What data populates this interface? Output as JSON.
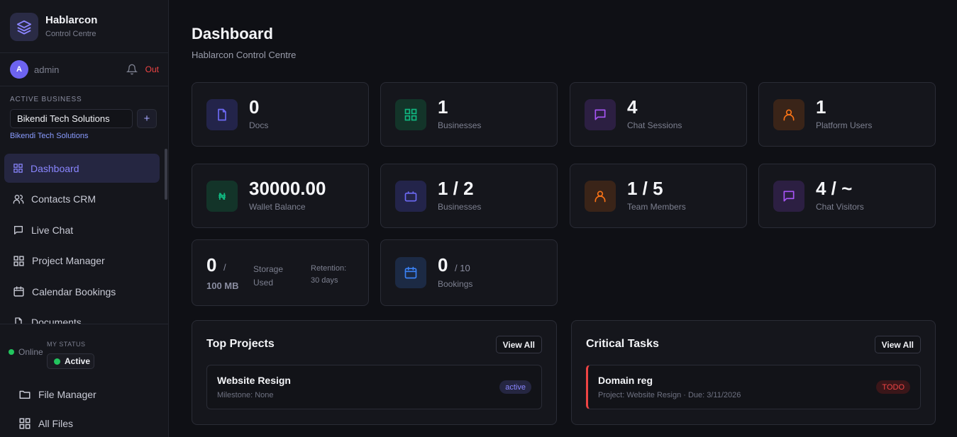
{
  "brand": {
    "name": "Hablarcon",
    "subtitle": "Control Centre"
  },
  "user": {
    "avatar_letter": "A",
    "name": "admin",
    "logout_label": "Out"
  },
  "business": {
    "section_label": "ACTIVE BUSINESS",
    "selected": "Bikendi Tech Solutions",
    "add_label": "+",
    "current_link": "Bikendi Tech Solutions"
  },
  "nav": [
    {
      "label": "Dashboard",
      "icon": "grid-icon",
      "active": true
    },
    {
      "label": "Contacts CRM",
      "icon": "users-icon"
    },
    {
      "label": "Live Chat",
      "icon": "chat-icon"
    },
    {
      "label": "Project Manager",
      "icon": "grid-icon"
    },
    {
      "label": "Calendar Bookings",
      "icon": "calendar-icon"
    },
    {
      "label": "Documents",
      "icon": "document-icon"
    }
  ],
  "status": {
    "online_label": "Online",
    "my_status_label": "MY STATUS",
    "current": "Active"
  },
  "bottom_nav": [
    {
      "label": "File Manager",
      "icon": "folder-icon"
    },
    {
      "label": "All Files",
      "icon": "grid-icon"
    }
  ],
  "page": {
    "title": "Dashboard",
    "subtitle": "Hablarcon Control Centre"
  },
  "stats_row1": [
    {
      "value": "0",
      "label": "Docs",
      "icon": "document-icon",
      "color": "#6366f1"
    },
    {
      "value": "1",
      "label": "Businesses",
      "icon": "grid-icon",
      "color": "#10b981"
    },
    {
      "value": "4",
      "label": "Chat Sessions",
      "icon": "chat-icon",
      "color": "#a855f7"
    },
    {
      "value": "1",
      "label": "Platform Users",
      "icon": "user-icon",
      "color": "#f97316"
    }
  ],
  "stats_row2": [
    {
      "value": "30000.00",
      "label": "Wallet Balance",
      "icon": "naira-icon",
      "glyph": "₦",
      "color": "#10b981"
    },
    {
      "value": "1 / 2",
      "label": "Businesses",
      "icon": "briefcase-icon",
      "color": "#6366f1"
    },
    {
      "value": "1 / 5",
      "label": "Team Members",
      "icon": "user-icon",
      "color": "#f97316"
    },
    {
      "value": "4 / ~",
      "label": "Chat Visitors",
      "icon": "chat-icon",
      "color": "#a855f7"
    }
  ],
  "storage": {
    "value": "0",
    "slash": "/",
    "total": "100 MB",
    "label_line1": "Storage",
    "label_line2": "Used",
    "retention_line1": "Retention:",
    "retention_line2": "30 days"
  },
  "bookings": {
    "value": "0",
    "total": "/ 10",
    "label": "Bookings",
    "icon": "calendar-icon",
    "color": "#3b82f6"
  },
  "top_projects": {
    "title": "Top Projects",
    "view_all": "View All",
    "items": [
      {
        "name": "Website Resign",
        "milestone": "Milestone: None",
        "status": "active"
      }
    ]
  },
  "critical_tasks": {
    "title": "Critical Tasks",
    "view_all": "View All",
    "items": [
      {
        "name": "Domain reg",
        "meta": "Project: Website Resign · Due: 3/11/2026",
        "status": "TODO"
      }
    ]
  },
  "colors": {
    "accent": "#6d63f0",
    "danger": "#ef4444",
    "success": "#22c55e"
  }
}
